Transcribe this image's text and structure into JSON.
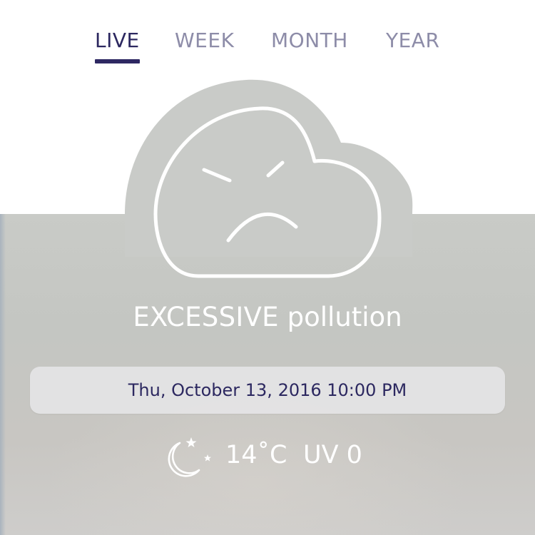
{
  "tabs": [
    {
      "label": "LIVE",
      "active": true
    },
    {
      "label": "WEEK",
      "active": false
    },
    {
      "label": "MONTH",
      "active": false
    },
    {
      "label": "YEAR",
      "active": false
    }
  ],
  "status": {
    "level": "EXCESSIVE",
    "suffix": "pollution",
    "face_icon": "sad-cloud-icon"
  },
  "datetime": "Thu, October 13, 2016 10:00 PM",
  "weather": {
    "icon": "moon-stars-icon",
    "temperature": "14˚C",
    "uv": "UV 0"
  },
  "colors": {
    "accent": "#2e2862",
    "tab_inactive": "#8d8ca8",
    "panel": "#c6c7c3",
    "cloud_fill": "#c9cbc8"
  }
}
